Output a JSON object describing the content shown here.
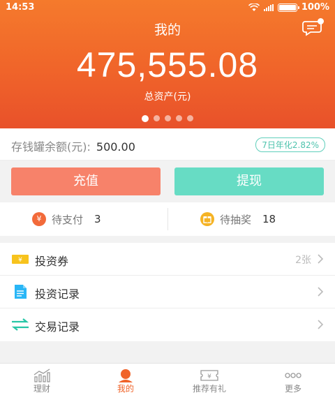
{
  "status_bar": {
    "time": "14:53",
    "battery": "100%"
  },
  "header": {
    "title": "我的"
  },
  "assets": {
    "amount": "475,555.08",
    "label": "总资产(元)",
    "pages": 5,
    "active_page": 0
  },
  "piggy_bank": {
    "label": "存钱罐余额(元):",
    "value": "500.00",
    "rate": "7日年化2.82%"
  },
  "actions": {
    "recharge": "充值",
    "withdraw": "提现"
  },
  "pending": {
    "payment": {
      "icon": "¥",
      "label": "待支付",
      "count": "3"
    },
    "lottery": {
      "label": "待抽奖",
      "count": "18"
    }
  },
  "menu": [
    {
      "label": "投资券",
      "extra": "2张",
      "icon": "coupon-icon"
    },
    {
      "label": "投资记录",
      "extra": "",
      "icon": "document-icon"
    },
    {
      "label": "交易记录",
      "extra": "",
      "icon": "transfer-arrows-icon"
    }
  ],
  "tabs": [
    {
      "label": "理财",
      "icon": "chart-icon"
    },
    {
      "label": "我的",
      "icon": "user-icon"
    },
    {
      "label": "推荐有礼",
      "icon": "ticket-icon"
    },
    {
      "label": "更多",
      "icon": "more-icon"
    }
  ],
  "colors": {
    "accent": "#f0642a",
    "recharge": "#f7826a",
    "withdraw": "#67dcc4",
    "rate": "#4ec3ad"
  }
}
